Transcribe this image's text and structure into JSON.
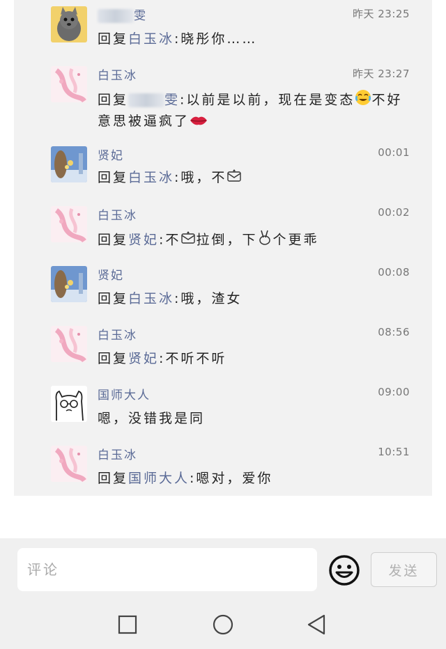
{
  "comments": [
    {
      "name": "雯",
      "name_redacted": true,
      "time": "昨天 23:25",
      "reply_prefix": "回复",
      "reply_to": "白玉冰",
      "text": ":晓彤你……"
    },
    {
      "name": "白玉冰",
      "time": "昨天 23:27",
      "reply_prefix": "回复",
      "reply_to": "雯",
      "reply_to_redacted": true,
      "text": ":以前是以前，现在是变态",
      "text2": "不好意思被逼疯了"
    },
    {
      "name": "贤妃",
      "time": "00:01",
      "reply_prefix": "回复",
      "reply_to": "白玉冰",
      "text": ":哦，不"
    },
    {
      "name": "白玉冰",
      "time": "00:02",
      "reply_prefix": "回复",
      "reply_to": "贤妃",
      "text": ":不",
      "text2": "拉倒，下",
      "text3": "个更乖"
    },
    {
      "name": "贤妃",
      "time": "00:08",
      "reply_prefix": "回复",
      "reply_to": "白玉冰",
      "text": ":哦，渣女"
    },
    {
      "name": "白玉冰",
      "time": "08:56",
      "reply_prefix": "回复",
      "reply_to": "贤妃",
      "text": ":不听不听"
    },
    {
      "name": "国师大人",
      "time": "09:00",
      "text": "嗯，没错我是同"
    },
    {
      "name": "白玉冰",
      "time": "10:51",
      "reply_prefix": "回复",
      "reply_to": "国师大人",
      "text": ":嗯对，爱你"
    }
  ],
  "input": {
    "placeholder": "评论",
    "send_label": "发送"
  },
  "icons": {
    "emoji": "smiley-icon",
    "nav": [
      "square-recents-icon",
      "circle-home-icon",
      "triangle-back-icon"
    ]
  },
  "colors": {
    "name": "#5a6a96",
    "thread_bg": "#f2f2f2"
  }
}
